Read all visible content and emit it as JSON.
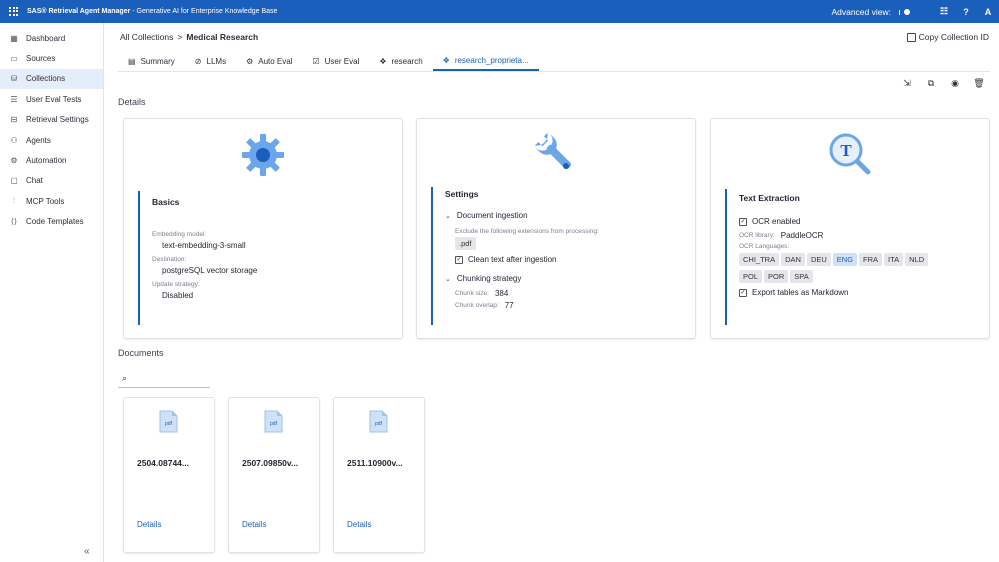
{
  "app": {
    "brand": "SAS® Retrieval Agent Manager",
    "subtitle": " - Generative AI for Enterprise Knowledge Base",
    "advanced_view_label": "Advanced view:",
    "user_initial": "A",
    "accent": "#1b5fbd"
  },
  "sidebar": {
    "items": [
      {
        "label": "Dashboard",
        "icon": "dashboard-icon",
        "glyph": "▦"
      },
      {
        "label": "Sources",
        "icon": "sources-icon",
        "glyph": "▭"
      },
      {
        "label": "Collections",
        "icon": "collections-icon",
        "glyph": "⛁"
      },
      {
        "label": "User Eval Tests",
        "icon": "user-eval-tests-icon",
        "glyph": "☰"
      },
      {
        "label": "Retrieval Settings",
        "icon": "retrieval-settings-icon",
        "glyph": "⊟"
      },
      {
        "label": "Agents",
        "icon": "agents-icon",
        "glyph": "⚇"
      },
      {
        "label": "Automation",
        "icon": "automation-icon",
        "glyph": "⚙"
      },
      {
        "label": "Chat",
        "icon": "chat-icon",
        "glyph": "▢"
      },
      {
        "label": "MCP Tools",
        "icon": "mcp-tools-icon",
        "glyph": "⫶"
      },
      {
        "label": "Code Templates",
        "icon": "code-templates-icon",
        "glyph": "⟨⟩"
      }
    ],
    "active_index": 2,
    "collapse_glyph": "«"
  },
  "breadcrumb": {
    "parent": "All Collections",
    "separator": ">",
    "current": "Medical Research"
  },
  "copy_collection_label": "Copy Collection ID",
  "tabs": [
    {
      "label": "Summary",
      "glyph": "▤"
    },
    {
      "label": "LLMs",
      "glyph": "⊘"
    },
    {
      "label": "Auto Eval",
      "glyph": "⚙"
    },
    {
      "label": "User Eval",
      "glyph": "☑"
    },
    {
      "label": "research",
      "glyph": "❖"
    },
    {
      "label": "research_proprieta...",
      "glyph": "❖"
    }
  ],
  "active_tab": 5,
  "details_title": "Details",
  "basics": {
    "title": "Basics",
    "embedding_label": "Embedding model:",
    "embedding_value": "text-embedding-3-small",
    "destination_label": "Destination:",
    "destination_value": "postgreSQL vector storage",
    "update_label": "Update strategy:",
    "update_value": "Disabled"
  },
  "settings": {
    "title": "Settings",
    "doc_ingestion": "Document ingestion",
    "exclude_label": "Exclude the following extensions from processing:",
    "exclude_chip": ".pdf",
    "clean_text": "Clean text after ingestion",
    "chunking": "Chunking strategy",
    "chunk_size_label": "Chunk size:",
    "chunk_size": "384",
    "chunk_overlap_label": "Chunk overlap:",
    "chunk_overlap": "77"
  },
  "text_extraction": {
    "title": "Text Extraction",
    "ocr_enabled": "OCR enabled",
    "ocr_library_label": "OCR library:",
    "ocr_library": "PaddleOCR",
    "ocr_languages_label": "OCR Languages:",
    "languages": [
      "CHI_TRA",
      "DAN",
      "DEU",
      "ENG",
      "FRA",
      "ITA",
      "NLD",
      "POL",
      "POR",
      "SPA"
    ],
    "selected_language": "ENG",
    "export_tables": "Export tables as Markdown"
  },
  "documents_title": "Documents",
  "search": {
    "placeholder": ""
  },
  "documents": [
    {
      "name": "2504.08744...",
      "link": "Details",
      "type": "pdf"
    },
    {
      "name": "2507.09850v...",
      "link": "Details",
      "type": "pdf"
    },
    {
      "name": "2511.10900v...",
      "link": "Details",
      "type": "pdf"
    }
  ]
}
